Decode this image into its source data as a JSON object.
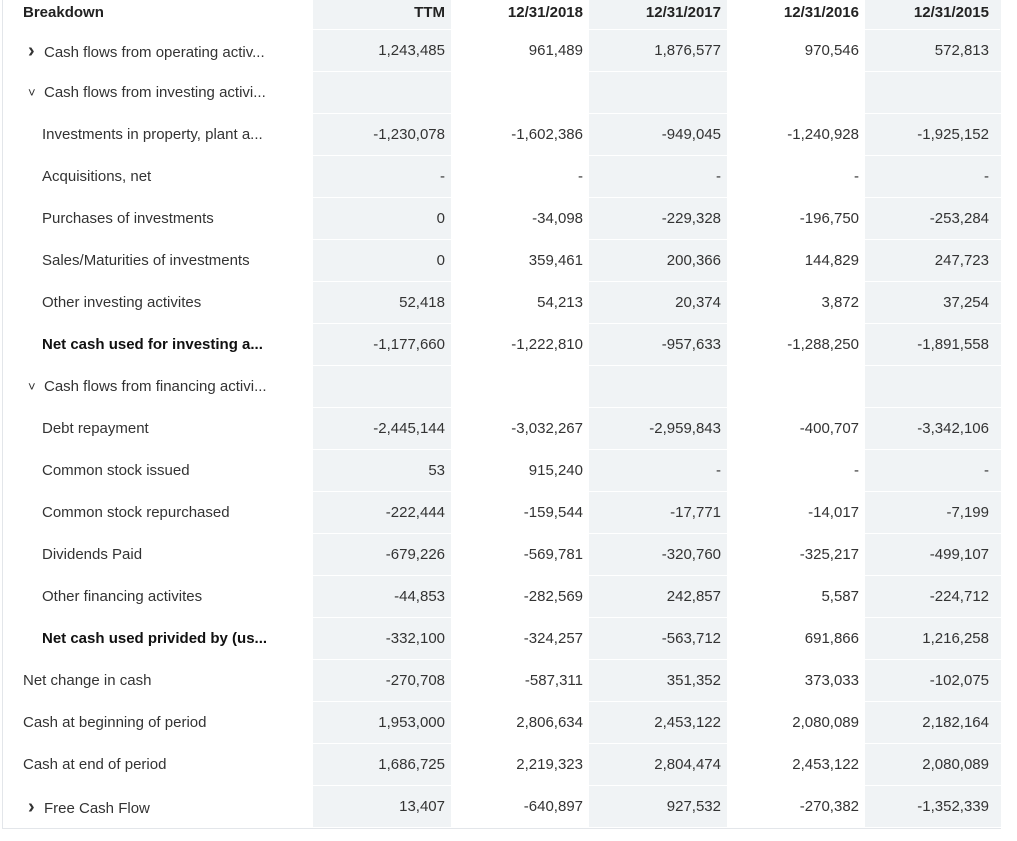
{
  "header": {
    "breakdown": "Breakdown",
    "columns": [
      "TTM",
      "12/31/2018",
      "12/31/2017",
      "12/31/2016",
      "12/31/2015"
    ]
  },
  "rows": [
    {
      "label": "Cash flows from operating activ...",
      "chevron": "›",
      "indent": 1,
      "highlight": true,
      "bold": false,
      "values": [
        "1,243,485",
        "961,489",
        "1,876,577",
        "970,546",
        "572,813"
      ]
    },
    {
      "label": "Cash flows from investing activi...",
      "chevron": "˅",
      "indent": 1,
      "highlight": false,
      "bold": false,
      "values": [
        "",
        "",
        "",
        "",
        ""
      ]
    },
    {
      "label": "Investments in property, plant a...",
      "chevron": "",
      "indent": 2,
      "highlight": true,
      "bold": false,
      "values": [
        "-1,230,078",
        "-1,602,386",
        "-949,045",
        "-1,240,928",
        "-1,925,152"
      ]
    },
    {
      "label": "Acquisitions, net",
      "chevron": "",
      "indent": 2,
      "highlight": false,
      "bold": false,
      "values": [
        "-",
        "-",
        "-",
        "-",
        "-"
      ]
    },
    {
      "label": "Purchases of investments",
      "chevron": "",
      "indent": 2,
      "highlight": false,
      "bold": false,
      "values": [
        "0",
        "-34,098",
        "-229,328",
        "-196,750",
        "-253,284"
      ]
    },
    {
      "label": "Sales/Maturities of investments",
      "chevron": "",
      "indent": 2,
      "highlight": false,
      "bold": false,
      "values": [
        "0",
        "359,461",
        "200,366",
        "144,829",
        "247,723"
      ]
    },
    {
      "label": "Other investing activites",
      "chevron": "",
      "indent": 2,
      "highlight": false,
      "bold": false,
      "values": [
        "52,418",
        "54,213",
        "20,374",
        "3,872",
        "37,254"
      ]
    },
    {
      "label": "Net cash used for investing a...",
      "chevron": "",
      "indent": 2,
      "highlight": true,
      "bold": true,
      "values": [
        "-1,177,660",
        "-1,222,810",
        "-957,633",
        "-1,288,250",
        "-1,891,558"
      ]
    },
    {
      "label": "Cash flows from financing activi...",
      "chevron": "˅",
      "indent": 1,
      "highlight": false,
      "bold": false,
      "values": [
        "",
        "",
        "",
        "",
        ""
      ]
    },
    {
      "label": "Debt repayment",
      "chevron": "",
      "indent": 2,
      "highlight": true,
      "bold": false,
      "values": [
        "-2,445,144",
        "-3,032,267",
        "-2,959,843",
        "-400,707",
        "-3,342,106"
      ]
    },
    {
      "label": "Common stock issued",
      "chevron": "",
      "indent": 2,
      "highlight": false,
      "bold": false,
      "values": [
        "53",
        "915,240",
        "-",
        "-",
        "-"
      ]
    },
    {
      "label": "Common stock repurchased",
      "chevron": "",
      "indent": 2,
      "highlight": true,
      "bold": false,
      "values": [
        "-222,444",
        "-159,544",
        "-17,771",
        "-14,017",
        "-7,199"
      ]
    },
    {
      "label": "Dividends Paid",
      "chevron": "",
      "indent": 2,
      "highlight": true,
      "bold": false,
      "values": [
        "-679,226",
        "-569,781",
        "-320,760",
        "-325,217",
        "-499,107"
      ]
    },
    {
      "label": "Other financing activites",
      "chevron": "",
      "indent": 2,
      "highlight": false,
      "bold": false,
      "values": [
        "-44,853",
        "-282,569",
        "242,857",
        "5,587",
        "-224,712"
      ]
    },
    {
      "label": "Net cash used privided by (us...",
      "chevron": "",
      "indent": 2,
      "highlight": true,
      "bold": true,
      "values": [
        "-332,100",
        "-324,257",
        "-563,712",
        "691,866",
        "1,216,258"
      ]
    },
    {
      "label": "Net change in cash",
      "chevron": "",
      "indent": 0,
      "highlight": true,
      "bold": false,
      "values": [
        "-270,708",
        "-587,311",
        "351,352",
        "373,033",
        "-102,075"
      ]
    },
    {
      "label": "Cash at beginning of period",
      "chevron": "",
      "indent": 0,
      "highlight": false,
      "bold": false,
      "values": [
        "1,953,000",
        "2,806,634",
        "2,453,122",
        "2,080,089",
        "2,182,164"
      ]
    },
    {
      "label": "Cash at end of period",
      "chevron": "",
      "indent": 0,
      "highlight": false,
      "bold": false,
      "values": [
        "1,686,725",
        "2,219,323",
        "2,804,474",
        "2,453,122",
        "2,080,089"
      ]
    },
    {
      "label": "Free Cash Flow",
      "chevron": "›",
      "indent": 1,
      "highlight": false,
      "bold": false,
      "values": [
        "13,407",
        "-640,897",
        "927,532",
        "-270,382",
        "-1,352,339"
      ]
    }
  ],
  "colors": {
    "shaded_column": "#f0f3f5",
    "highlight": "#fbff2a",
    "border": "#e3e6ea"
  }
}
